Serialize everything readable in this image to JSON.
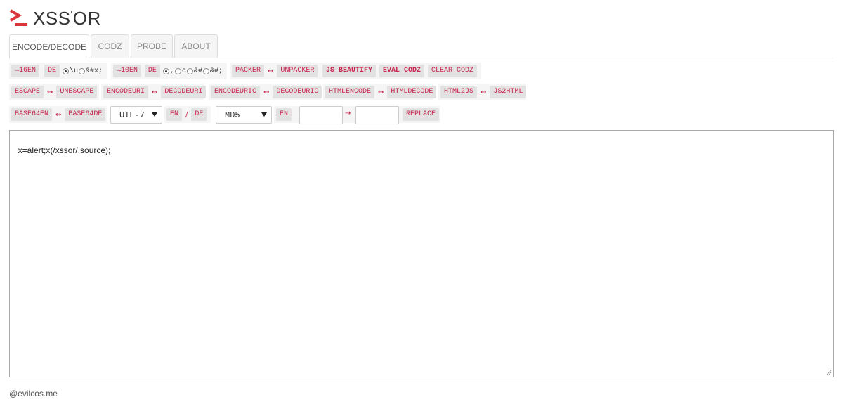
{
  "header": {
    "logo_icon": "terminal-prompt-icon",
    "title": "XSS",
    "title_mark": "'",
    "title_suffix": "OR"
  },
  "tabs": [
    {
      "label": "ENCODE/DECODE",
      "active": true
    },
    {
      "label": "CODZ"
    },
    {
      "label": "PROBE"
    },
    {
      "label": "ABOUT"
    }
  ],
  "row1": {
    "hex_en": "→16EN",
    "hex_de": "DE",
    "hex_radio_1": "\\u",
    "hex_radio_2": "&#x;",
    "dec_en": "→10EN",
    "dec_de": "DE",
    "dec_radio_1": ",",
    "dec_radio_2": "c",
    "dec_radio_3": "&#",
    "dec_radio_4": "&#;",
    "packer": "PACKER",
    "unpacker": "UNPACKER",
    "js_beautify": "JS BEAUTIFY",
    "eval_codz": "EVAL CODZ",
    "clear_codz": "CLEAR CODZ",
    "arrow": "↔"
  },
  "row2": {
    "escape": "ESCAPE",
    "unescape": "UNESCAPE",
    "encodeuri": "ENCODEURI",
    "decodeuri": "DECODEURI",
    "encodeuric": "ENCODEURIC",
    "decodeuric": "DECODEURIC",
    "htmlencode": "HTMLENCODE",
    "htmldecode": "HTMLDECODE",
    "html2js": "HTML2JS",
    "js2html": "JS2HTML",
    "arrow": "↔"
  },
  "row3": {
    "base64en": "BASE64EN",
    "base64de": "BASE64DE",
    "arrow": "↔",
    "charset_selected": "UTF-7",
    "charset_en": "EN",
    "slash": "/",
    "charset_de": "DE",
    "hash_selected": "MD5",
    "hash_en": "EN",
    "replace_arrow": "→",
    "replace": "REPLACE",
    "find_value": "",
    "replace_value": ""
  },
  "editor": {
    "content": "x=alert;x(/xssor/.source);"
  },
  "footer": {
    "text": "@evilcos.me"
  },
  "colors": {
    "accent": "#c7254e",
    "logo": "#d9363e"
  }
}
